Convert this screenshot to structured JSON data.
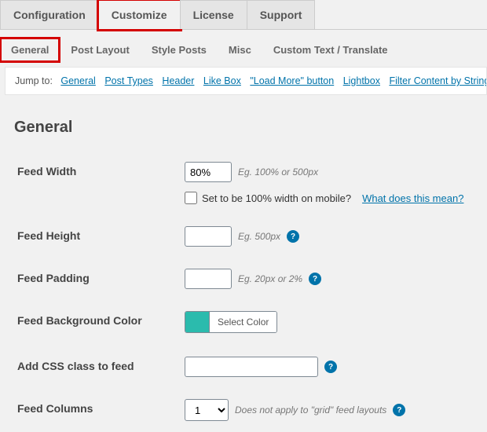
{
  "mainTabs": {
    "configuration": "Configuration",
    "customize": "Customize",
    "license": "License",
    "support": "Support"
  },
  "subTabs": {
    "general": "General",
    "post_layout": "Post Layout",
    "style_posts": "Style Posts",
    "misc": "Misc",
    "custom_text": "Custom Text / Translate"
  },
  "jump": {
    "label": "Jump to:",
    "links": {
      "general": "General",
      "post_types": "Post Types",
      "header": "Header",
      "like_box": "Like Box",
      "load_more": "\"Load More\" button",
      "lightbox": "Lightbox",
      "filter": "Filter Content by String"
    }
  },
  "section": {
    "title": "General"
  },
  "fields": {
    "feed_width": {
      "label": "Feed Width",
      "value": "80%",
      "hint": "Eg. 100% or 500px",
      "mobile_check_label": "Set to be 100% width on mobile?",
      "what_link": "What does this mean?"
    },
    "feed_height": {
      "label": "Feed Height",
      "value": "",
      "hint": "Eg. 500px"
    },
    "feed_padding": {
      "label": "Feed Padding",
      "value": "",
      "hint": "Eg. 20px or 2%"
    },
    "bg_color": {
      "label": "Feed Background Color",
      "swatch": "#2bbbad",
      "button": "Select Color"
    },
    "css_class": {
      "label": "Add CSS class to feed",
      "value": ""
    },
    "columns": {
      "label": "Feed Columns",
      "value": "1",
      "hint": "Does not apply to \"grid\" feed layouts"
    }
  }
}
